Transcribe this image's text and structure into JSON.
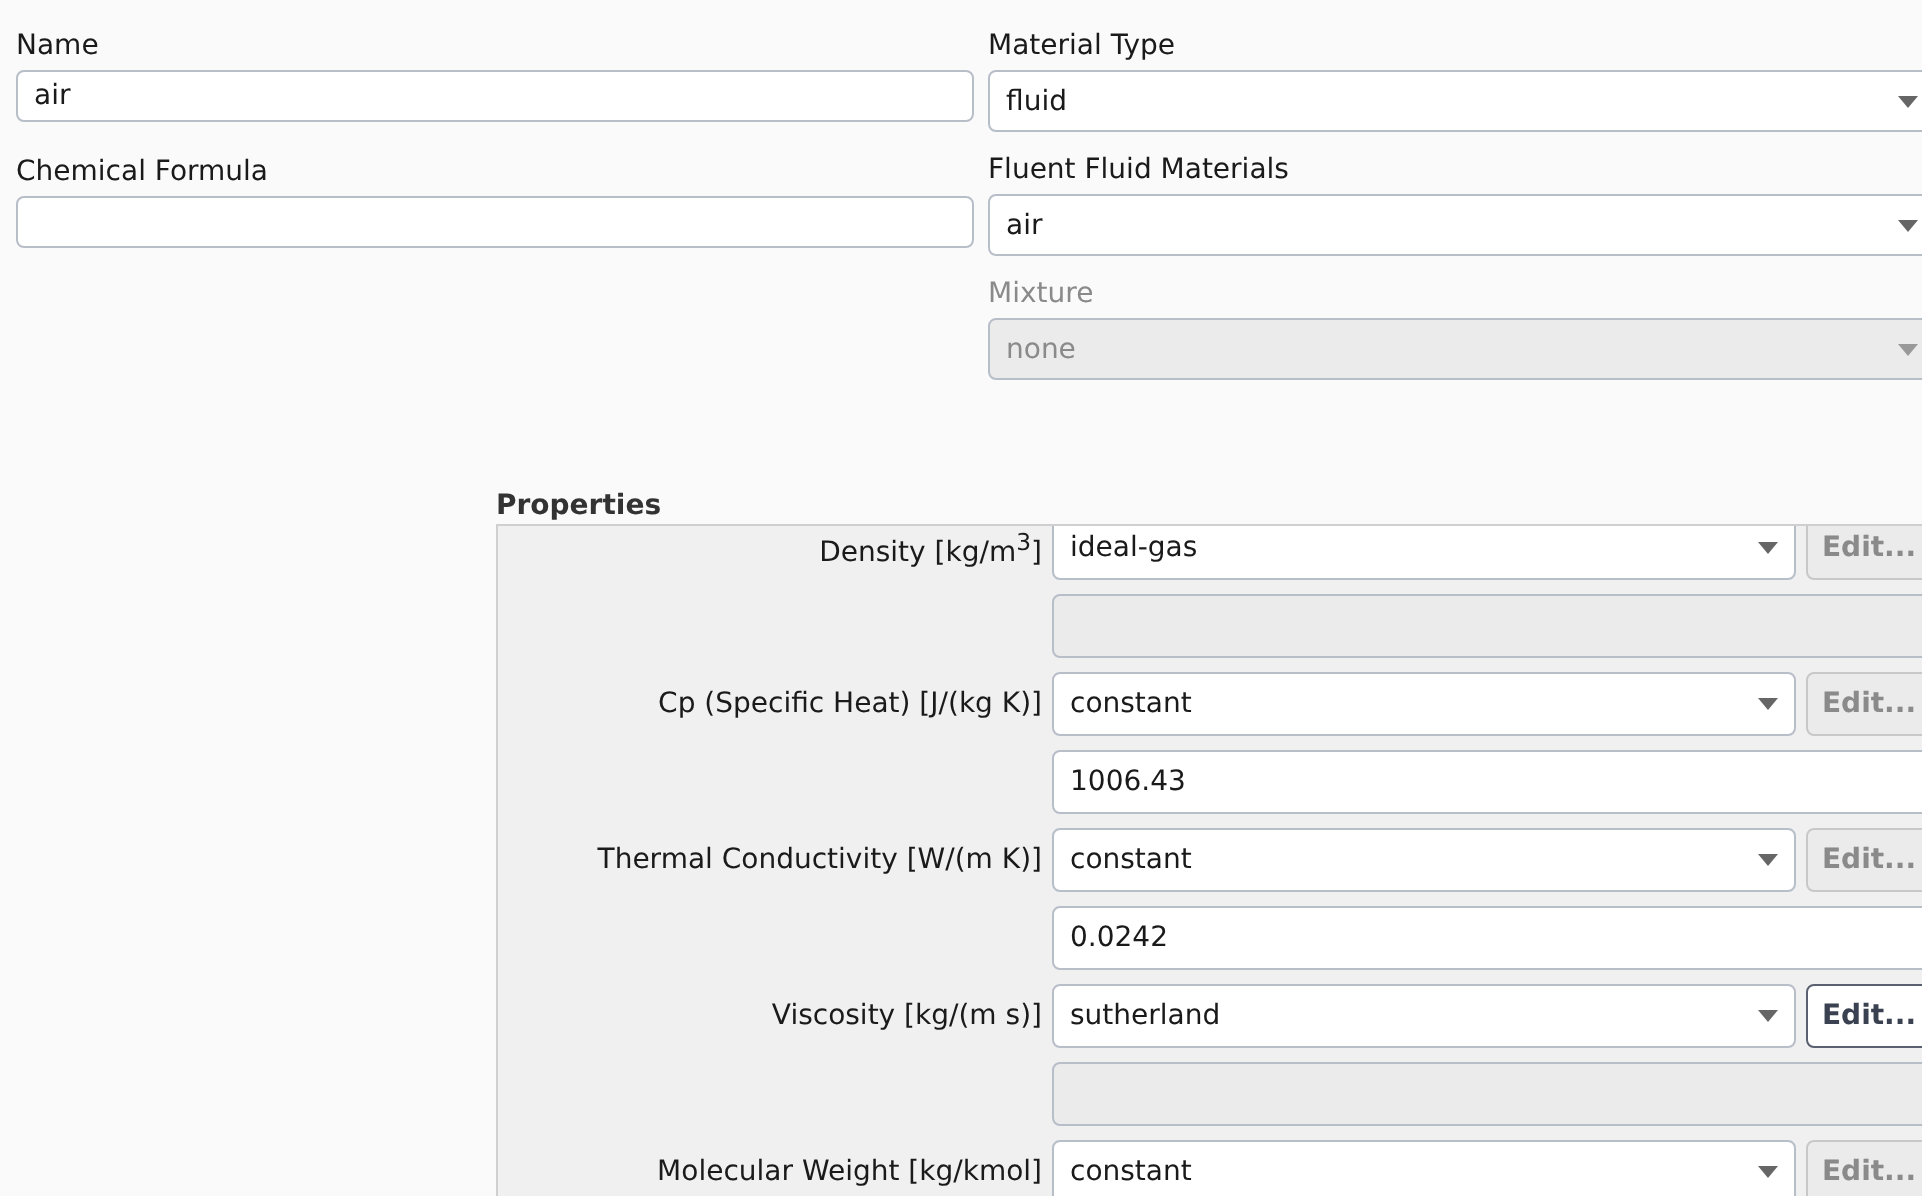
{
  "left_fields": [
    {
      "label": "Name",
      "value": "air"
    },
    {
      "label": "Chemical Formula"
    }
  ],
  "right_fields": [
    {
      "label": "Material Type",
      "value": "fluid",
      "disabled": false
    },
    {
      "label": "Fluent Fluid Materials",
      "value": "air",
      "disabled": false
    },
    {
      "label": "Mixture",
      "value": "none",
      "disabled": true
    }
  ],
  "properties": {
    "title": "Properties",
    "rows": [
      {
        "label": "Density [kg/m$^{3}$]",
        "method": "ideal-gas",
        "edit_label": "Edit...",
        "edit_enabled": false,
        "value_field": {
          "disabled": true
        }
      },
      {
        "label": "Cp (Specific Heat) [J/(kg K)]",
        "method": "constant",
        "edit_label": "Edit...",
        "edit_enabled": false,
        "value_field": {
          "value": "1006.43",
          "disabled": false
        }
      },
      {
        "label": "Thermal Conductivity [W/(m K)]",
        "method": "constant",
        "edit_label": "Edit...",
        "edit_enabled": false,
        "value_field": {
          "value": "0.0242",
          "disabled": false
        }
      },
      {
        "label": "Viscosity [kg/(m s)]",
        "method": "sutherland",
        "edit_label": "Edit...",
        "edit_enabled": true,
        "value_field": {
          "disabled": true
        }
      },
      {
        "label": "Molecular Weight [kg/kmol]",
        "method": "constant",
        "edit_label": "Edit...",
        "edit_enabled": false
      }
    ]
  }
}
